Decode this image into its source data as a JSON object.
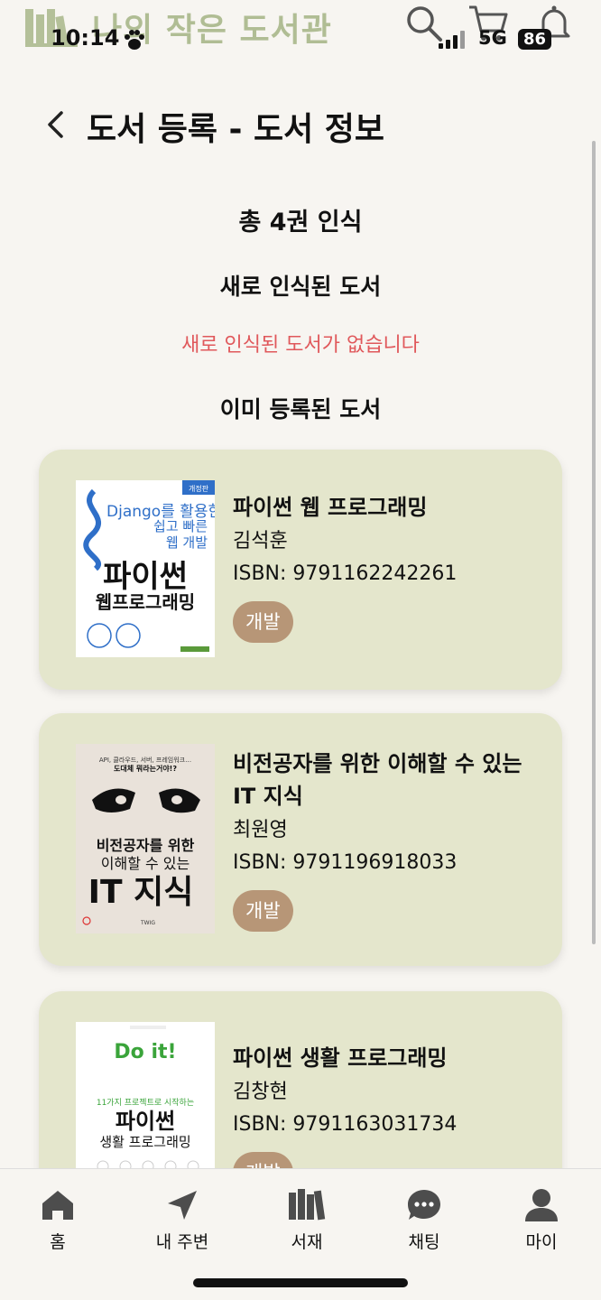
{
  "app": {
    "logo_text": "나의 작은 도서관"
  },
  "status_bar": {
    "time": "10:14",
    "network": "5G",
    "battery": "86"
  },
  "header": {
    "back_icon": "chevron-left-icon",
    "title": "도서 등록 - 도서 정보"
  },
  "summary": {
    "total": "총 4권 인식",
    "new_heading": "새로 인식된 도서",
    "new_empty": "새로 인식된 도서가 없습니다",
    "registered_heading": "이미 등록된 도서"
  },
  "books": [
    {
      "title": "파이썬 웹 프로그래밍",
      "author": "김석훈",
      "isbn": "ISBN: 9791162242261",
      "tag": "개발",
      "cover": {
        "line1": "Django를 활용한",
        "line2": "쉽고 빠른",
        "line3": "웹 개발",
        "big1": "파이썬",
        "big2": "웹프로그래밍",
        "badge": "개정판"
      }
    },
    {
      "title": "비전공자를 위한 이해할 수 있는 IT 지식",
      "author": "최원영",
      "isbn": "ISBN: 9791196918033",
      "tag": "개발",
      "cover": {
        "small": "API, 클라우드, 서버, 프레임워크…",
        "small2": "도대체 뭐라는거야!?",
        "line1": "비전공자를 위한",
        "line2": "이해할 수 있는",
        "big": "IT 지식",
        "pub": "TWIG"
      }
    },
    {
      "title": "파이썬 생활 프로그래밍",
      "author": "김창현",
      "isbn": "ISBN: 9791163031734",
      "tag": "개발",
      "cover": {
        "doit": "Do it!",
        "line1": "11가지 프로젝트로 시작하는",
        "big": "파이썬",
        "line2": "생활 프로그래밍"
      }
    }
  ],
  "tabbar": [
    {
      "label": "홈",
      "icon": "home-icon"
    },
    {
      "label": "내 주변",
      "icon": "location-arrow-icon"
    },
    {
      "label": "서재",
      "icon": "bookshelf-icon"
    },
    {
      "label": "채팅",
      "icon": "chat-bubble-icon"
    },
    {
      "label": "마이",
      "icon": "user-icon"
    }
  ],
  "colors": {
    "background": "#f7f5f1",
    "card": "#e4e6cc",
    "tag": "#b79677",
    "error": "#e0585b",
    "logo": "#a9b78a"
  }
}
